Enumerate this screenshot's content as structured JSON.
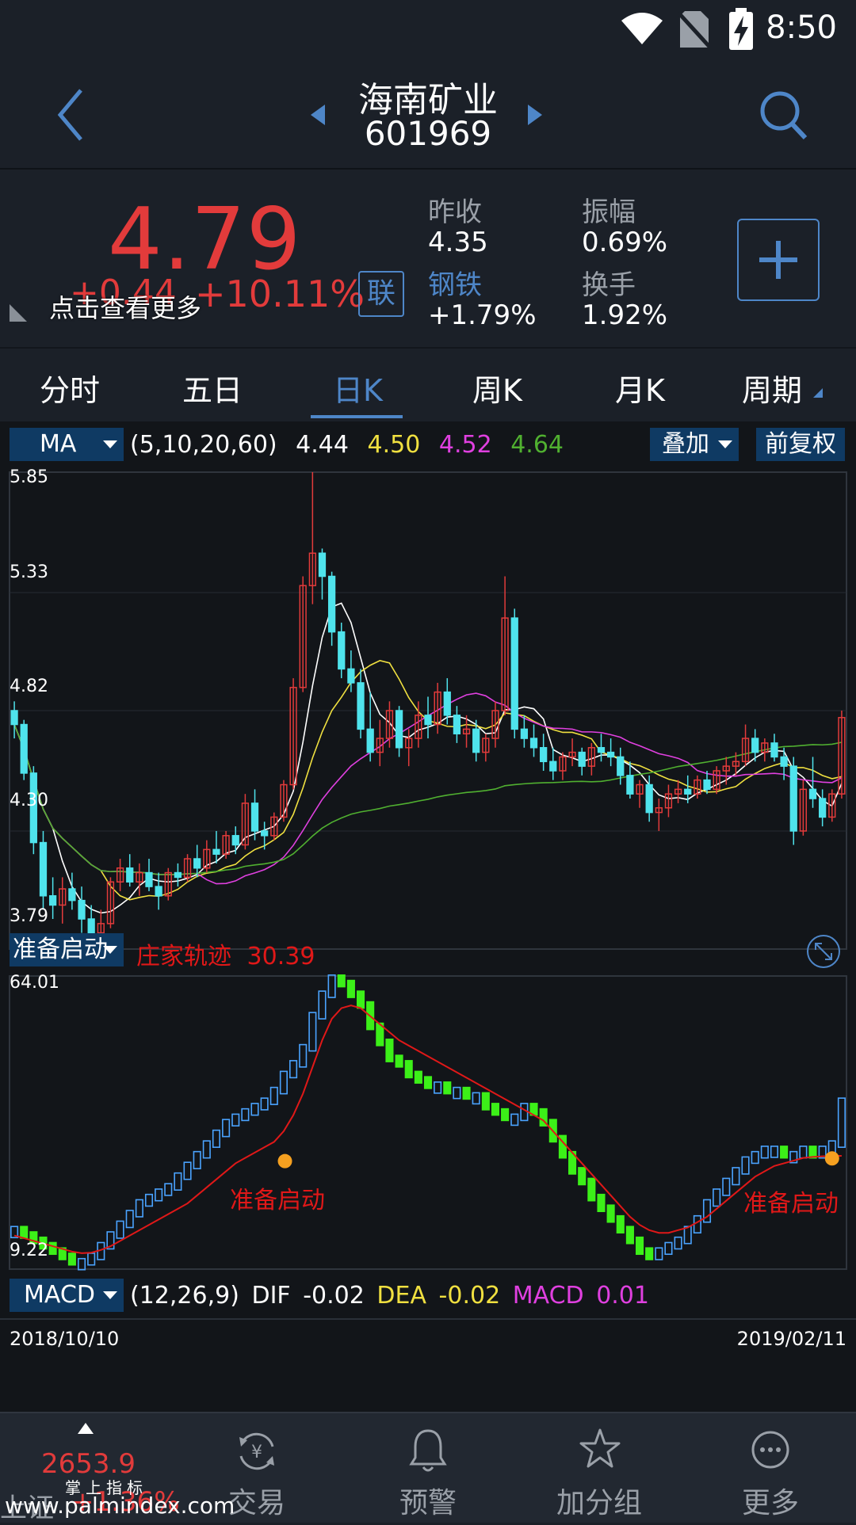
{
  "status_bar": {
    "time": "8:50"
  },
  "header": {
    "name": "海南矿业",
    "code": "601969"
  },
  "quote": {
    "price": "4.79",
    "change": "+0.44",
    "change_pct": "+10.11%",
    "more_tip": "点击查看更多",
    "lian": "联",
    "prev_close_label": "昨收",
    "prev_close": "4.35",
    "amplitude_label": "振幅",
    "amplitude": "0.69%",
    "sector": "钢铁",
    "sector_change": "+1.79%",
    "turnover_label": "换手",
    "turnover": "1.92%"
  },
  "tabs": [
    {
      "label": "分时"
    },
    {
      "label": "五日"
    },
    {
      "label": "日K",
      "active": true
    },
    {
      "label": "周K"
    },
    {
      "label": "月K"
    },
    {
      "label": "周期"
    }
  ],
  "main_chart": {
    "indicator": "MA",
    "params": "(5,10,20,60)",
    "ma5": "4.44",
    "ma10": "4.50",
    "ma20": "4.52",
    "ma60": "4.64",
    "overlay_button": "叠加",
    "adjust_button": "前复权",
    "y_labels": [
      "5.85",
      "5.33",
      "4.82",
      "4.30",
      "3.79"
    ]
  },
  "sub_chart": {
    "indicator": "准备启动",
    "series_label": "庄家轨迹",
    "series_value": "30.39",
    "y_top": "64.01",
    "y_bottom": "9.22",
    "signal_text_1": "准备启动",
    "signal_text_2": "准备启动"
  },
  "macd": {
    "indicator": "MACD",
    "params": "(12,26,9)",
    "dif_label": "DIF",
    "dif": "-0.02",
    "dea_label": "DEA",
    "dea": "-0.02",
    "macd_label": "MACD",
    "macd": "0.01"
  },
  "dates": {
    "start": "2018/10/10",
    "end": "2019/02/11"
  },
  "bottom_nav": {
    "index_value": "2653.9",
    "index_change": "+1.36%",
    "index_name": "上证",
    "items": [
      "交易",
      "预警",
      "加分组",
      "更多"
    ]
  },
  "watermark": {
    "small": "掌上指标",
    "url": "www.palmindex.com"
  },
  "colors": {
    "up": "#e23b3b",
    "down": "#4fe3ec",
    "accent": "#4e86c8",
    "ma5": "#ffffff",
    "ma10": "#f0e040",
    "ma20": "#e040e0",
    "ma60": "#50b030",
    "sub_up": "#4aa3ff",
    "sub_down": "#3cf018",
    "track": "#e01818"
  },
  "chart_data": [
    {
      "type": "candlestick",
      "title": "",
      "ylim": [
        3.79,
        5.85
      ],
      "x_range": [
        "2018/10/10",
        "2019/02/11"
      ],
      "ohlc": [
        [
          4.82,
          4.86,
          4.7,
          4.76
        ],
        [
          4.76,
          4.78,
          4.52,
          4.55
        ],
        [
          4.55,
          4.58,
          4.2,
          4.25
        ],
        [
          4.25,
          4.3,
          3.96,
          4.02
        ],
        [
          4.02,
          4.1,
          3.92,
          3.98
        ],
        [
          3.98,
          4.1,
          3.9,
          4.05
        ],
        [
          4.05,
          4.12,
          3.96,
          4.0
        ],
        [
          4.0,
          4.06,
          3.86,
          3.92
        ],
        [
          3.92,
          3.98,
          3.8,
          3.86
        ],
        [
          3.86,
          3.96,
          3.82,
          3.9
        ],
        [
          3.9,
          4.1,
          3.88,
          4.08
        ],
        [
          4.08,
          4.18,
          4.04,
          4.14
        ],
        [
          4.14,
          4.2,
          4.06,
          4.08
        ],
        [
          4.08,
          4.16,
          4.02,
          4.12
        ],
        [
          4.12,
          4.18,
          4.04,
          4.06
        ],
        [
          4.06,
          4.12,
          3.96,
          4.02
        ],
        [
          4.02,
          4.14,
          4.0,
          4.12
        ],
        [
          4.12,
          4.16,
          4.06,
          4.1
        ],
        [
          4.1,
          4.2,
          4.08,
          4.18
        ],
        [
          4.18,
          4.24,
          4.1,
          4.14
        ],
        [
          4.14,
          4.26,
          4.12,
          4.22
        ],
        [
          4.22,
          4.3,
          4.16,
          4.2
        ],
        [
          4.2,
          4.3,
          4.18,
          4.28
        ],
        [
          4.28,
          4.32,
          4.2,
          4.24
        ],
        [
          4.24,
          4.46,
          4.22,
          4.42
        ],
        [
          4.42,
          4.48,
          4.26,
          4.3
        ],
        [
          4.3,
          4.34,
          4.22,
          4.28
        ],
        [
          4.28,
          4.38,
          4.26,
          4.36
        ],
        [
          4.36,
          4.52,
          4.34,
          4.5
        ],
        [
          4.5,
          4.96,
          4.48,
          4.92
        ],
        [
          4.92,
          5.4,
          4.9,
          5.36
        ],
        [
          5.36,
          5.85,
          5.28,
          5.5
        ],
        [
          5.5,
          5.52,
          5.3,
          5.4
        ],
        [
          5.4,
          5.42,
          5.1,
          5.16
        ],
        [
          5.16,
          5.2,
          4.96,
          5.0
        ],
        [
          5.0,
          5.08,
          4.9,
          4.94
        ],
        [
          4.94,
          5.0,
          4.7,
          4.74
        ],
        [
          4.74,
          4.9,
          4.6,
          4.64
        ],
        [
          4.64,
          4.78,
          4.58,
          4.7
        ],
        [
          4.7,
          4.86,
          4.66,
          4.82
        ],
        [
          4.82,
          4.84,
          4.62,
          4.66
        ],
        [
          4.66,
          4.74,
          4.58,
          4.7
        ],
        [
          4.7,
          4.86,
          4.66,
          4.8
        ],
        [
          4.8,
          4.88,
          4.7,
          4.76
        ],
        [
          4.76,
          4.94,
          4.72,
          4.9
        ],
        [
          4.9,
          4.96,
          4.76,
          4.8
        ],
        [
          4.8,
          4.84,
          4.68,
          4.72
        ],
        [
          4.72,
          4.8,
          4.66,
          4.74
        ],
        [
          4.74,
          4.78,
          4.6,
          4.64
        ],
        [
          4.64,
          4.72,
          4.6,
          4.7
        ],
        [
          4.7,
          4.86,
          4.66,
          4.82
        ],
        [
          4.82,
          5.4,
          4.8,
          5.22
        ],
        [
          5.22,
          5.26,
          4.7,
          4.74
        ],
        [
          4.74,
          4.8,
          4.66,
          4.7
        ],
        [
          4.7,
          4.76,
          4.62,
          4.66
        ],
        [
          4.66,
          4.72,
          4.56,
          4.6
        ],
        [
          4.6,
          4.66,
          4.52,
          4.56
        ],
        [
          4.56,
          4.64,
          4.52,
          4.62
        ],
        [
          4.62,
          4.7,
          4.58,
          4.64
        ],
        [
          4.64,
          4.66,
          4.54,
          4.58
        ],
        [
          4.58,
          4.68,
          4.54,
          4.66
        ],
        [
          4.66,
          4.72,
          4.6,
          4.64
        ],
        [
          4.64,
          4.7,
          4.58,
          4.62
        ],
        [
          4.62,
          4.66,
          4.5,
          4.54
        ],
        [
          4.54,
          4.6,
          4.44,
          4.46
        ],
        [
          4.46,
          4.52,
          4.4,
          4.5
        ],
        [
          4.5,
          4.54,
          4.34,
          4.38
        ],
        [
          4.38,
          4.44,
          4.3,
          4.4
        ],
        [
          4.4,
          4.5,
          4.36,
          4.46
        ],
        [
          4.46,
          4.52,
          4.42,
          4.48
        ],
        [
          4.48,
          4.54,
          4.42,
          4.46
        ],
        [
          4.46,
          4.54,
          4.44,
          4.52
        ],
        [
          4.52,
          4.56,
          4.46,
          4.48
        ],
        [
          4.48,
          4.58,
          4.46,
          4.56
        ],
        [
          4.56,
          4.62,
          4.5,
          4.58
        ],
        [
          4.58,
          4.64,
          4.54,
          4.6
        ],
        [
          4.6,
          4.76,
          4.58,
          4.7
        ],
        [
          4.7,
          4.74,
          4.6,
          4.64
        ],
        [
          4.64,
          4.7,
          4.6,
          4.68
        ],
        [
          4.68,
          4.72,
          4.6,
          4.62
        ],
        [
          4.62,
          4.66,
          4.52,
          4.58
        ],
        [
          4.58,
          4.62,
          4.24,
          4.3
        ],
        [
          4.3,
          4.52,
          4.28,
          4.48
        ],
        [
          4.48,
          4.62,
          4.4,
          4.44
        ],
        [
          4.44,
          4.48,
          4.32,
          4.36
        ],
        [
          4.36,
          4.48,
          4.34,
          4.46
        ],
        [
          4.46,
          4.82,
          4.44,
          4.79
        ]
      ]
    },
    {
      "type": "bar",
      "title": "",
      "ylim": [
        9.22,
        64.01
      ],
      "series": [
        {
          "name": "准备启动",
          "values": [
            16,
            15,
            14,
            13,
            12,
            11,
            10,
            10,
            11,
            13,
            15,
            17,
            19,
            21,
            22,
            23,
            24,
            26,
            28,
            30,
            32,
            34,
            36,
            37,
            38,
            39,
            40,
            42,
            45,
            47,
            50,
            56,
            60,
            63,
            62,
            60,
            58,
            54,
            51,
            48,
            47,
            45,
            44,
            43,
            43,
            42,
            42,
            41,
            41,
            39,
            38,
            37,
            37,
            39,
            38,
            36,
            33,
            30,
            27,
            25,
            22,
            20,
            18,
            16,
            14,
            12,
            11,
            12,
            13,
            14,
            16,
            18,
            21,
            23,
            25,
            27,
            29,
            30,
            31,
            31,
            30,
            30,
            31,
            30,
            31,
            32,
            40
          ]
        },
        {
          "name": "庄家轨迹",
          "values": [
            15.5,
            15,
            14.5,
            14,
            13.5,
            13,
            12.5,
            12.2,
            12.3,
            12.8,
            13.5,
            14.5,
            15.5,
            16.5,
            17.5,
            18.5,
            19.5,
            20.5,
            21.5,
            23,
            24.5,
            26,
            27.5,
            29,
            30,
            31,
            32,
            33,
            35,
            38,
            42,
            47,
            52,
            56,
            58,
            58.5,
            58,
            56.5,
            55,
            53.5,
            52,
            51,
            50,
            49,
            48,
            47,
            46,
            45,
            44,
            43,
            42,
            41,
            40,
            39,
            38,
            37,
            35,
            33,
            31,
            29,
            27,
            25,
            23,
            21,
            19,
            17.5,
            16.5,
            16,
            16,
            16.5,
            17,
            18,
            19,
            20.5,
            22,
            23.5,
            25,
            26.5,
            27.5,
            28.5,
            29,
            29.5,
            30,
            30.2,
            30.3,
            30.35,
            30.39
          ]
        }
      ]
    }
  ]
}
